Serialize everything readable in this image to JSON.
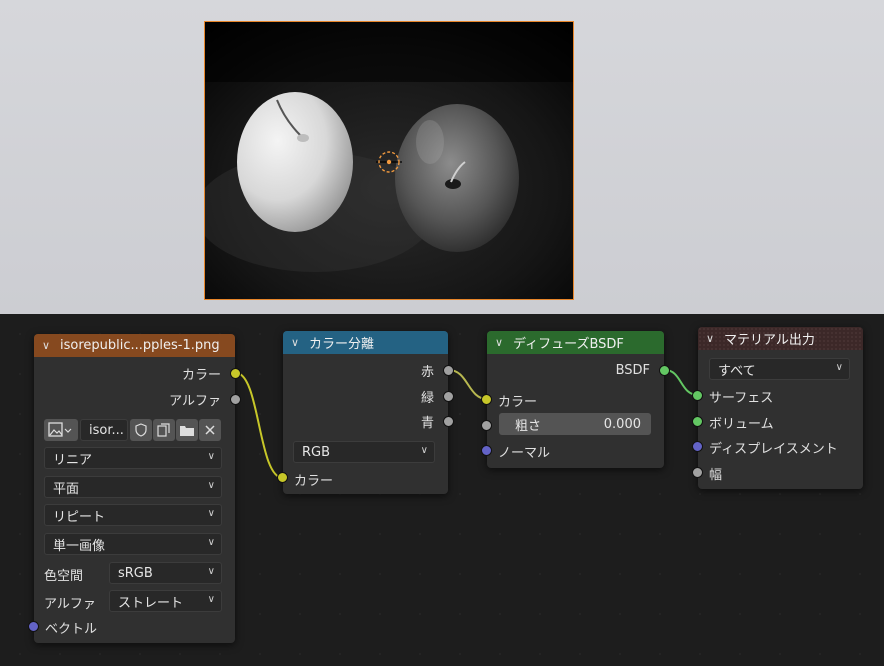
{
  "image_node": {
    "title": "isorepublic...pples-1.png",
    "out_color": "カラー",
    "out_alpha": "アルファ",
    "image_name": "isor...",
    "interpolation": "リニア",
    "projection": "平面",
    "extension": "リピート",
    "source": "単一画像",
    "colorspace_label": "色空間",
    "colorspace_value": "sRGB",
    "alpha_label": "アルファ",
    "alpha_value": "ストレート",
    "in_vector": "ベクトル",
    "header_color": "#86491f"
  },
  "separate_node": {
    "title": "カラー分離",
    "out_r": "赤",
    "out_g": "緑",
    "out_b": "青",
    "mode": "RGB",
    "in_color": "カラー",
    "header_color": "#246283"
  },
  "diffuse_node": {
    "title": "ディフューズBSDF",
    "out_bsdf": "BSDF",
    "in_color": "カラー",
    "roughness_label": "粗さ",
    "roughness_value": "0.000",
    "in_normal": "ノーマル",
    "header_color": "#2b6a2d"
  },
  "output_node": {
    "title": "マテリアル出力",
    "target": "すべて",
    "in_surface": "サーフェス",
    "in_volume": "ボリューム",
    "in_displacement": "ディスプレイスメント",
    "in_width": "幅",
    "header_color": "#3c2828"
  }
}
